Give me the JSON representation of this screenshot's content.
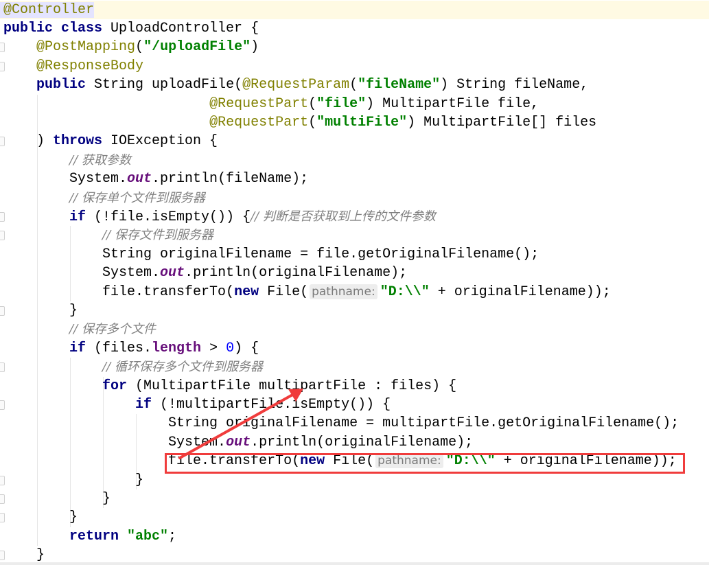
{
  "editor": {
    "language": "java",
    "lines": [
      {
        "tokens": [
          {
            "t": "@Controller",
            "c": "ann anno-hl"
          }
        ]
      },
      {
        "tokens": [
          {
            "t": "public class ",
            "c": "kw"
          },
          {
            "t": "UploadController {",
            "c": ""
          }
        ]
      },
      {
        "tokens": [
          {
            "t": "    ",
            "c": ""
          },
          {
            "t": "@PostMapping",
            "c": "ann"
          },
          {
            "t": "(",
            "c": ""
          },
          {
            "t": "\"/uploadFile\"",
            "c": "str"
          },
          {
            "t": ")",
            "c": ""
          }
        ]
      },
      {
        "tokens": [
          {
            "t": "    ",
            "c": ""
          },
          {
            "t": "@ResponseBody",
            "c": "ann"
          }
        ]
      },
      {
        "tokens": [
          {
            "t": "    ",
            "c": ""
          },
          {
            "t": "public ",
            "c": "kw"
          },
          {
            "t": "String uploadFile(",
            "c": ""
          },
          {
            "t": "@RequestParam",
            "c": "ann"
          },
          {
            "t": "(",
            "c": ""
          },
          {
            "t": "\"fileName\"",
            "c": "str"
          },
          {
            "t": ") String fileName,",
            "c": ""
          }
        ]
      },
      {
        "tokens": [
          {
            "t": "                         ",
            "c": ""
          },
          {
            "t": "@RequestPart",
            "c": "ann"
          },
          {
            "t": "(",
            "c": ""
          },
          {
            "t": "\"file\"",
            "c": "str"
          },
          {
            "t": ") MultipartFile file,",
            "c": ""
          }
        ]
      },
      {
        "tokens": [
          {
            "t": "                         ",
            "c": ""
          },
          {
            "t": "@RequestPart",
            "c": "ann"
          },
          {
            "t": "(",
            "c": ""
          },
          {
            "t": "\"multiFile\"",
            "c": "str"
          },
          {
            "t": ") MultipartFile[] files",
            "c": ""
          }
        ]
      },
      {
        "tokens": [
          {
            "t": "    ) ",
            "c": ""
          },
          {
            "t": "throws ",
            "c": "kw"
          },
          {
            "t": "IOException {",
            "c": ""
          }
        ]
      },
      {
        "tokens": [
          {
            "t": "        ",
            "c": ""
          },
          {
            "t": "// 获取参数",
            "c": "cmt"
          }
        ]
      },
      {
        "tokens": [
          {
            "t": "        System.",
            "c": ""
          },
          {
            "t": "out",
            "c": "field"
          },
          {
            "t": ".println(fileName);",
            "c": ""
          }
        ]
      },
      {
        "tokens": [
          {
            "t": "        ",
            "c": ""
          },
          {
            "t": "// 保存单个文件到服务器",
            "c": "cmt"
          }
        ]
      },
      {
        "tokens": [
          {
            "t": "        ",
            "c": ""
          },
          {
            "t": "if ",
            "c": "kw"
          },
          {
            "t": "(!file.isEmpty()) {",
            "c": ""
          },
          {
            "t": "// 判断是否获取到上传的文件参数",
            "c": "cmt"
          }
        ]
      },
      {
        "tokens": [
          {
            "t": "            ",
            "c": ""
          },
          {
            "t": "// 保存文件到服务器",
            "c": "cmt"
          }
        ]
      },
      {
        "tokens": [
          {
            "t": "            String originalFilename = file.getOriginalFilename();",
            "c": ""
          }
        ]
      },
      {
        "tokens": [
          {
            "t": "            System.",
            "c": ""
          },
          {
            "t": "out",
            "c": "field"
          },
          {
            "t": ".println(originalFilename);",
            "c": ""
          }
        ]
      },
      {
        "tokens": [
          {
            "t": "            file.transferTo(",
            "c": ""
          },
          {
            "t": "new ",
            "c": "kw"
          },
          {
            "t": "File(",
            "c": ""
          },
          {
            "t": "pathname:",
            "c": "hint"
          },
          {
            "t": "\"D:\\\\\"",
            "c": "str"
          },
          {
            "t": " + originalFilename));",
            "c": ""
          }
        ]
      },
      {
        "tokens": [
          {
            "t": "        }",
            "c": ""
          }
        ]
      },
      {
        "tokens": [
          {
            "t": "        ",
            "c": ""
          },
          {
            "t": "// 保存多个文件",
            "c": "cmt"
          }
        ]
      },
      {
        "tokens": [
          {
            "t": "        ",
            "c": ""
          },
          {
            "t": "if ",
            "c": "kw"
          },
          {
            "t": "(files.",
            "c": ""
          },
          {
            "t": "length",
            "c": "field-plain"
          },
          {
            "t": " > ",
            "c": ""
          },
          {
            "t": "0",
            "c": "num"
          },
          {
            "t": ") {",
            "c": ""
          }
        ]
      },
      {
        "tokens": [
          {
            "t": "            ",
            "c": ""
          },
          {
            "t": "// 循环保存多个文件到服务器",
            "c": "cmt"
          }
        ]
      },
      {
        "tokens": [
          {
            "t": "            ",
            "c": ""
          },
          {
            "t": "for ",
            "c": "kw"
          },
          {
            "t": "(MultipartFile multipartFile : files) {",
            "c": ""
          }
        ]
      },
      {
        "tokens": [
          {
            "t": "                ",
            "c": ""
          },
          {
            "t": "if ",
            "c": "kw"
          },
          {
            "t": "(!multipartFile.isEmpty()) {",
            "c": ""
          }
        ]
      },
      {
        "tokens": [
          {
            "t": "                    String originalFilename = multipartFile.getOriginalFilename();",
            "c": ""
          }
        ]
      },
      {
        "tokens": [
          {
            "t": "                    System.",
            "c": ""
          },
          {
            "t": "out",
            "c": "field"
          },
          {
            "t": ".println(originalFilename);",
            "c": ""
          }
        ]
      },
      {
        "tokens": [
          {
            "t": "                    file.transferTo(",
            "c": ""
          },
          {
            "t": "new ",
            "c": "kw"
          },
          {
            "t": "File(",
            "c": ""
          },
          {
            "t": "pathname:",
            "c": "hint"
          },
          {
            "t": "\"D:\\\\\"",
            "c": "str"
          },
          {
            "t": " + originalFilename));",
            "c": ""
          }
        ]
      },
      {
        "tokens": [
          {
            "t": "                }",
            "c": ""
          }
        ]
      },
      {
        "tokens": [
          {
            "t": "            }",
            "c": ""
          }
        ]
      },
      {
        "tokens": [
          {
            "t": "        }",
            "c": ""
          }
        ]
      },
      {
        "tokens": [
          {
            "t": "        ",
            "c": ""
          },
          {
            "t": "return ",
            "c": "kw"
          },
          {
            "t": "\"abc\"",
            "c": "str"
          },
          {
            "t": ";",
            "c": ""
          }
        ]
      },
      {
        "tokens": [
          {
            "t": "    }",
            "c": ""
          }
        ]
      }
    ],
    "current_line_index": 0
  },
  "annotations": {
    "highlight_box_line_index": 24,
    "highlight_color": "#f03c3c",
    "arrow_from_description": "highlighted line 'file.transferTo' in loop",
    "arrow_to_description": "multipartFile loop variable"
  }
}
